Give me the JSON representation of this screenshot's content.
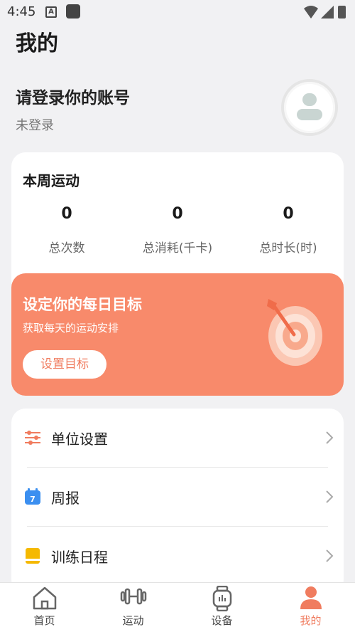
{
  "status_bar": {
    "time": "4:45",
    "a_icon_letter": "A"
  },
  "page": {
    "title": "我的"
  },
  "login": {
    "title": "请登录你的账号",
    "subtitle": "未登录"
  },
  "week": {
    "title": "本周运动",
    "stats": [
      {
        "value": "0",
        "label": "总次数"
      },
      {
        "value": "0",
        "label": "总消耗(千卡)"
      },
      {
        "value": "0",
        "label": "总时长(时)"
      }
    ]
  },
  "goal": {
    "title": "设定你的每日目标",
    "subtitle": "获取每天的运动安排",
    "button": "设置目标",
    "icon": "target-arrow-icon"
  },
  "menu": [
    {
      "label": "单位设置",
      "icon": "sliders-icon"
    },
    {
      "label": "周报",
      "icon": "calendar-icon",
      "badge": "7"
    },
    {
      "label": "训练日程",
      "icon": "notebook-icon"
    }
  ],
  "tabs": [
    {
      "label": "首页",
      "icon": "home-icon",
      "active": false
    },
    {
      "label": "运动",
      "icon": "dumbbell-icon",
      "active": false
    },
    {
      "label": "设备",
      "icon": "watch-icon",
      "active": false
    },
    {
      "label": "我的",
      "icon": "person-icon",
      "active": true
    }
  ],
  "colors": {
    "accent": "#f07c5f",
    "goal_bg": "#f88a6b",
    "calendar_blue": "#3b8ff0",
    "notebook_yellow": "#f5b900"
  }
}
